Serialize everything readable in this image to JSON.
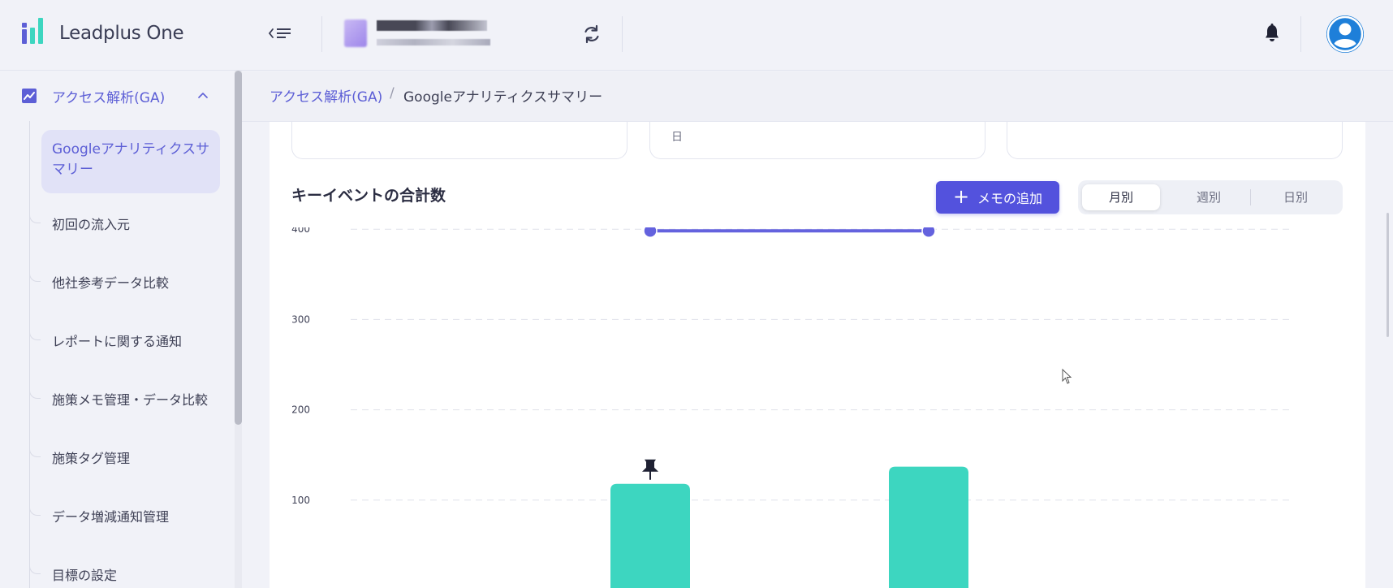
{
  "app": {
    "name": "Leadplus One"
  },
  "sidebar": {
    "section": "アクセス解析(GA)",
    "active": "Googleアナリティクスサマリー",
    "items": [
      "初回の流入元",
      "他社参考データ比較",
      "レポートに関する通知",
      "施策メモ管理・データ比較",
      "施策タグ管理",
      "データ増減通知管理",
      "目標の設定"
    ]
  },
  "breadcrumb": {
    "parent": "アクセス解析(GA)",
    "separator": "/",
    "current": "Googleアナリティクスサマリー"
  },
  "kpi": {
    "day_label": "日"
  },
  "chart_header": {
    "title": "キーイベントの合計数",
    "memo_button": "メモの追加",
    "periods": [
      "月別",
      "週別",
      "日別"
    ],
    "selected_period": "月別"
  },
  "chart_data": {
    "type": "bar",
    "yticks": [
      100,
      200,
      300,
      400
    ],
    "bars": [
      {
        "value": 118,
        "pinned": true
      },
      {
        "value": 137,
        "pinned": false
      }
    ],
    "line_values": [
      400,
      400
    ],
    "colors": {
      "bar": "#3dd6c0",
      "line": "#6462de",
      "grid": "#dfe1ea"
    }
  }
}
